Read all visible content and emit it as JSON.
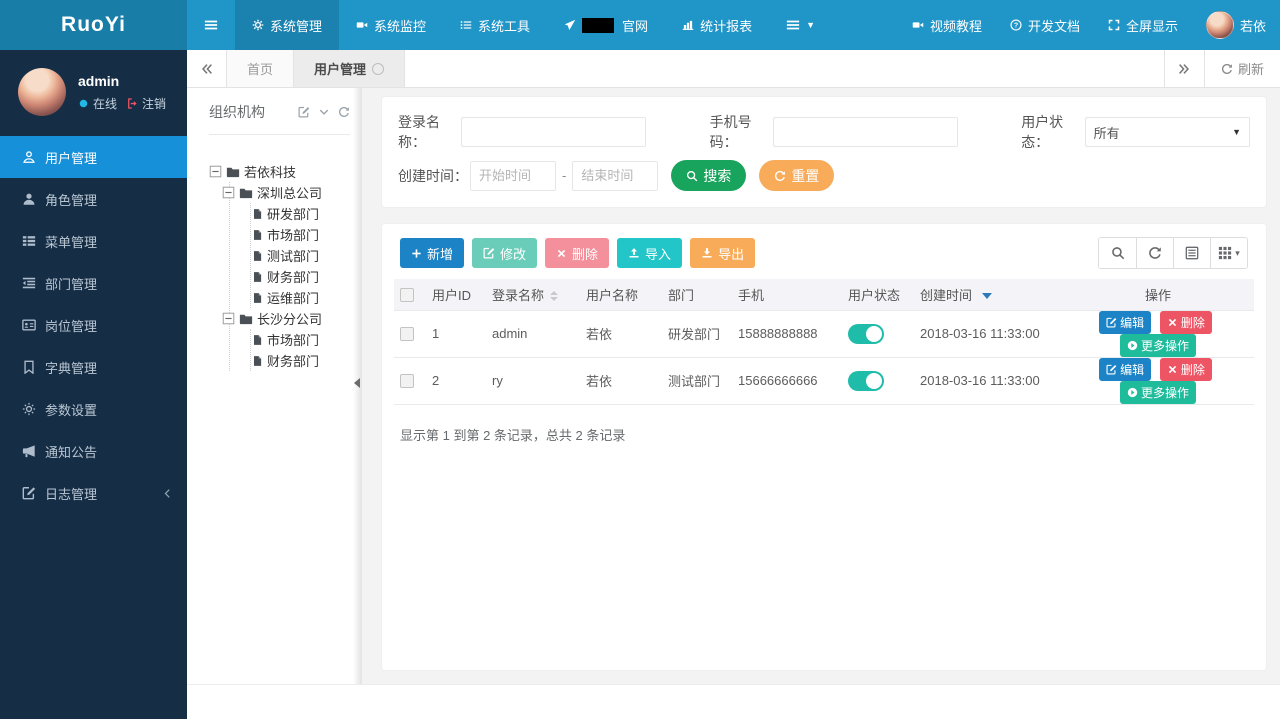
{
  "colors": {
    "navbar": "#1f95c8",
    "logo_bg": "#187ea8",
    "sidebar": "#152e46",
    "sidebar_active": "#1690d9",
    "primary_blue": "#1c84c6",
    "search_green": "#18a45c",
    "import_teal": "#23c6c8",
    "more_teal": "#1fbc9c",
    "orange": "#f8ac59",
    "danger_red": "#ed5565",
    "toggle_on": "#1fbcaa",
    "online_dot": "#23b7e5"
  },
  "navbar": {
    "logo": "RuoYi",
    "menu": [
      {
        "label": "系统管理"
      },
      {
        "label": "系统监控"
      },
      {
        "label": "系统工具"
      },
      {
        "label": "官网"
      },
      {
        "label": "统计报表"
      }
    ],
    "right": [
      {
        "label": "视频教程"
      },
      {
        "label": "开发文档"
      },
      {
        "label": "全屏显示"
      },
      {
        "label": "若依"
      }
    ]
  },
  "sidebar": {
    "user": {
      "name": "admin",
      "online": "在线",
      "logout": "注销"
    },
    "items": [
      {
        "label": "用户管理"
      },
      {
        "label": "角色管理"
      },
      {
        "label": "菜单管理"
      },
      {
        "label": "部门管理"
      },
      {
        "label": "岗位管理"
      },
      {
        "label": "字典管理"
      },
      {
        "label": "参数设置"
      },
      {
        "label": "通知公告"
      },
      {
        "label": "日志管理"
      }
    ]
  },
  "tabs": {
    "home": "首页",
    "current": "用户管理",
    "refresh": "刷新"
  },
  "tree": {
    "title": "组织机构",
    "nodes": [
      {
        "label": "若依科技"
      },
      {
        "label": "深圳总公司"
      },
      {
        "label": "研发部门"
      },
      {
        "label": "市场部门"
      },
      {
        "label": "测试部门"
      },
      {
        "label": "财务部门"
      },
      {
        "label": "运维部门"
      },
      {
        "label": "长沙分公司"
      },
      {
        "label": "市场部门"
      },
      {
        "label": "财务部门"
      }
    ]
  },
  "search": {
    "login_label": "登录名称：",
    "phone_label": "手机号码：",
    "status_label": "用户状态：",
    "status_value": "所有",
    "created_label": "创建时间：",
    "start_placeholder": "开始时间",
    "end_placeholder": "结束时间",
    "separator": "-",
    "search_btn": "搜索",
    "reset_btn": "重置"
  },
  "toolbar": {
    "add": "新增",
    "edit": "修改",
    "delete": "删除",
    "import": "导入",
    "export": "导出"
  },
  "table": {
    "col_id": "用户ID",
    "col_login": "登录名称",
    "col_name": "用户名称",
    "col_dept": "部门",
    "col_phone": "手机",
    "col_status": "用户状态",
    "col_created": "创建时间",
    "col_ops": "操作",
    "rows": [
      {
        "id": "1",
        "login": "admin",
        "name": "若依",
        "dept": "研发部门",
        "phone": "15888888888",
        "created": "2018-03-16 11:33:00"
      },
      {
        "id": "2",
        "login": "ry",
        "name": "若依",
        "dept": "测试部门",
        "phone": "15666666666",
        "created": "2018-03-16 11:33:00"
      }
    ],
    "actions": {
      "edit": "编辑",
      "delete": "删除",
      "more": "更多操作"
    },
    "summary": "显示第 1 到第 2 条记录，总共 2 条记录"
  }
}
